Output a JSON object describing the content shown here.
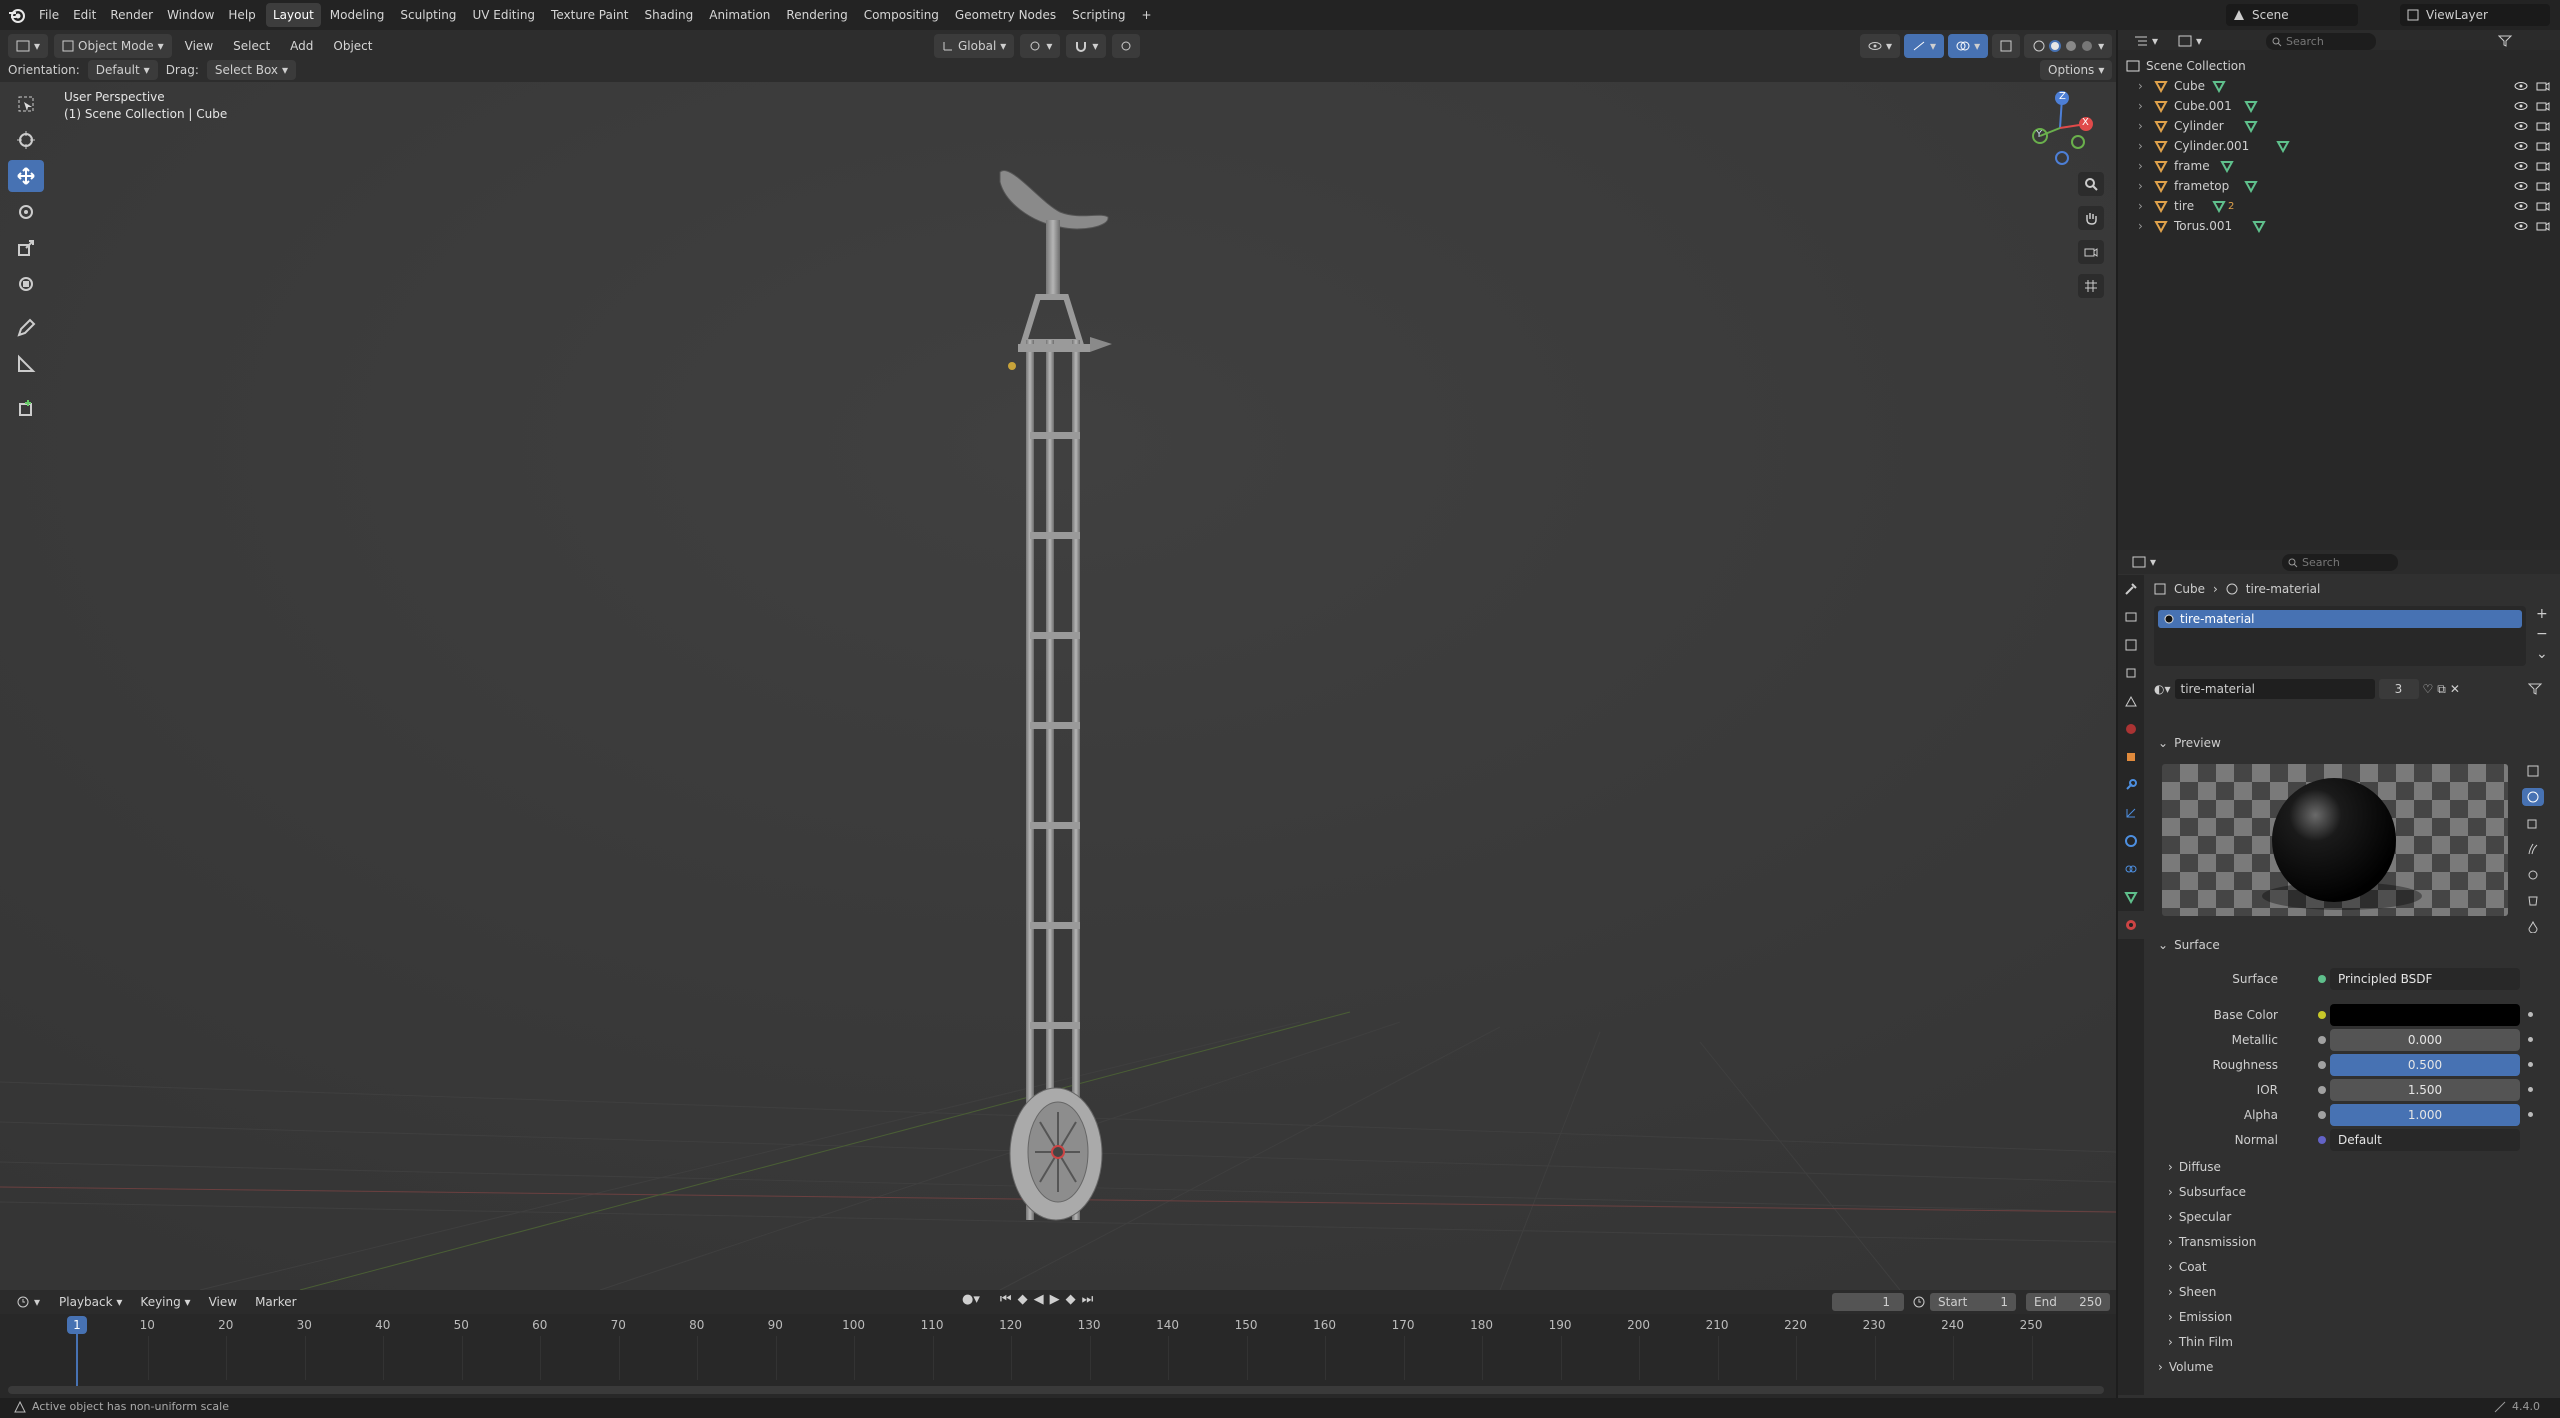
{
  "topbar": {
    "menus": [
      "File",
      "Edit",
      "Render",
      "Window",
      "Help"
    ],
    "workspaces": [
      "Layout",
      "Modeling",
      "Sculpting",
      "UV Editing",
      "Texture Paint",
      "Shading",
      "Animation",
      "Rendering",
      "Compositing",
      "Geometry Nodes",
      "Scripting"
    ],
    "active_workspace": "Layout",
    "add_tab": "+",
    "scene": "Scene",
    "view_layer": "ViewLayer"
  },
  "viewport_header": {
    "mode": "Object Mode",
    "menus": [
      "View",
      "Select",
      "Add",
      "Object"
    ],
    "transform_orientation": "Global",
    "orientation_label": "Orientation:",
    "orientation_value": "Default",
    "drag_label": "Drag:",
    "drag_value": "Select Box",
    "options": "Options"
  },
  "viewport": {
    "perspective": "User Perspective",
    "context": "(1) Scene Collection | Cube",
    "gizmo_axes": {
      "x": "X",
      "y": "Y",
      "z": "Z"
    }
  },
  "outliner": {
    "search_placeholder": "Search",
    "root": "Scene Collection",
    "items": [
      {
        "name": "Cube"
      },
      {
        "name": "Cube.001"
      },
      {
        "name": "Cylinder"
      },
      {
        "name": "Cylinder.001"
      },
      {
        "name": "frame"
      },
      {
        "name": "frametop"
      },
      {
        "name": "tire"
      },
      {
        "name": "Torus.001"
      }
    ],
    "tire_badge": "2"
  },
  "properties": {
    "search_placeholder": "Search",
    "breadcrumb_object": "Cube",
    "breadcrumb_material": "tire-material",
    "slot_name": "tire-material",
    "material_name": "tire-material",
    "material_users": "3",
    "preview_label": "Preview",
    "surface_label": "Surface",
    "rows": [
      {
        "label": "Surface",
        "value": "Principled BSDF"
      },
      {
        "label": "Base Color",
        "value": ""
      },
      {
        "label": "Metallic",
        "value": "0.000",
        "fill": 0
      },
      {
        "label": "Roughness",
        "value": "0.500",
        "fill": 1
      },
      {
        "label": "IOR",
        "value": "1.500",
        "fill": 0
      },
      {
        "label": "Alpha",
        "value": "1.000",
        "fill": 1
      },
      {
        "label": "Normal",
        "value": "Default"
      }
    ],
    "subsections": [
      "Diffuse",
      "Subsurface",
      "Specular",
      "Transmission",
      "Coat",
      "Sheen",
      "Emission",
      "Thin Film"
    ],
    "volume": "Volume"
  },
  "timeline": {
    "menus": [
      "Playback",
      "Keying",
      "View",
      "Marker"
    ],
    "current_frame": "1",
    "start_label": "Start",
    "start": "1",
    "end_label": "End",
    "end": "250",
    "playhead": "1",
    "ticks": [
      "10",
      "20",
      "30",
      "40",
      "50",
      "60",
      "70",
      "80",
      "90",
      "100",
      "110",
      "120",
      "130",
      "140",
      "150",
      "160",
      "170",
      "180",
      "190",
      "200",
      "210",
      "220",
      "230",
      "240",
      "250"
    ]
  },
  "status": {
    "message": "Active object has non-uniform scale",
    "version": "4.4.0"
  },
  "colors": {
    "accent": "#4772b3",
    "viewport_bg": "#393939",
    "outliner_icon": "#e0a24b",
    "mesh_icon": "#5fc08c"
  }
}
